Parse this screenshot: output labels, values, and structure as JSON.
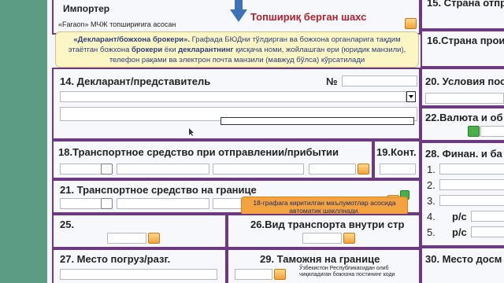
{
  "form": {
    "importer": {
      "label": "Импортер",
      "value": "«Faraon» МЧЖ топшириғига асосан"
    },
    "callout_top": {
      "text": "Топшириқ берган шахс"
    },
    "tooltip_declarant": {
      "bold1": "«Декларант/божхона брокери».",
      "part1": " Графада БЮДни тўлдирган ва божхона органларига тақдим этаётган божхона ",
      "bold2": "брокери",
      "part2": " ёки ",
      "bold3": "декларантнинг",
      "part3": " қисқача номи, жойлашган ери (юридик манзили), телефон рақами ва электрон почта манзили (мавжуд бўлса) кўрсатилади"
    },
    "box14": {
      "label": "14. Декларант/представитель",
      "num_label": "№"
    },
    "box15": {
      "label": "15. Страна отпр"
    },
    "box16": {
      "label": "16.Страна прои"
    },
    "box18": {
      "label": "18.Транспортное средство при отправлении/прибытии"
    },
    "box19": {
      "label": "19.Конт."
    },
    "box20": {
      "label": "20. Условия пос"
    },
    "box21": {
      "label": "21. Транспортное средство на границе"
    },
    "box22": {
      "label": "22.Валюта и об"
    },
    "box25": {
      "label": "25."
    },
    "box26": {
      "label": "26.Вид транспорта внутри стр"
    },
    "box27": {
      "label": "27. Место погруз/разг."
    },
    "box28": {
      "label": "28. Финан. и ба",
      "rows": [
        "1.",
        "2.",
        "3.",
        "4.",
        "5."
      ],
      "ps": [
        "р/с",
        "р/с"
      ]
    },
    "box29": {
      "label": "29. Таможня на границе"
    },
    "box30": {
      "label": "30. Место досм"
    },
    "tooltip_18": {
      "text": "18-графага киритилган маълумотлар асосида автоматик шакллнади."
    },
    "note_bottom": {
      "text": "Ўзбекистон Республикасидан олиб чиқиладиган божхона постининг коди"
    }
  },
  "colors": {
    "border": "#6d3a82",
    "tooltip_bg": "#fbf6c4",
    "callout_text": "#b2202d",
    "tooltip_orange": "#f3a33f"
  }
}
